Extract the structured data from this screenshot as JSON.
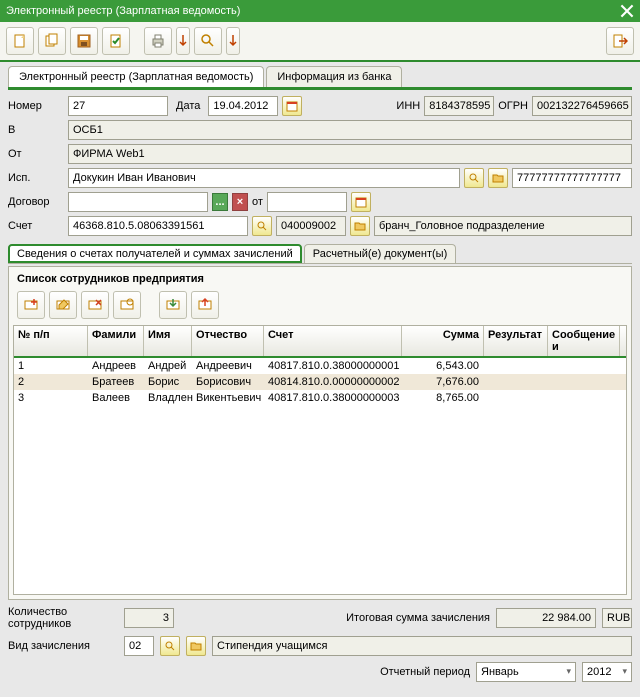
{
  "window": {
    "title": "Электронный реестр (Зарплатная ведомость)"
  },
  "tabs": {
    "main": "Электронный реестр (Зарплатная ведомость)",
    "bank": "Информация из банка"
  },
  "form": {
    "number_lbl": "Номер",
    "number": "27",
    "date_lbl": "Дата",
    "date": "19.04.2012",
    "inn_lbl": "ИНН",
    "inn": "8184378595",
    "ogrn_lbl": "ОГРН",
    "ogrn": "002132276459665",
    "to_lbl": "В",
    "to": "ОСБ1",
    "from_lbl": "От",
    "from": "ФИРМА Web1",
    "exec_lbl": "Исп.",
    "exec": "Докукин Иван Иванович",
    "phone": "77777777777777777",
    "contract_lbl": "Договор",
    "contract": "",
    "ot": "от",
    "contract_date": "",
    "acct_lbl": "Счет",
    "acct": "46368.810.5.08063391561",
    "acct2": "040009002",
    "branch": "бранч_Головное подразделение"
  },
  "subtabs": {
    "details": "Сведения о счетах получателей и суммах зачислений",
    "docs": "Расчетный(е) документ(ы)"
  },
  "list_title": "Список сотрудников предприятия",
  "cols": {
    "n": "№ п/п",
    "fam": "Фамили",
    "name": "Имя",
    "pat": "Отчество",
    "acct": "Счет",
    "sum": "Сумма",
    "res": "Результат",
    "msg": "Сообщение и"
  },
  "rows": [
    {
      "n": "1",
      "fam": "Андреев",
      "name": "Андрей",
      "pat": "Андреевич",
      "acct": "40817.810.0.38000000001",
      "sum": "6,543.00"
    },
    {
      "n": "2",
      "fam": "Братеев",
      "name": "Борис",
      "pat": "Борисович",
      "acct": "40814.810.0.00000000002",
      "sum": "7,676.00"
    },
    {
      "n": "3",
      "fam": "Валеев",
      "name": "Владлен",
      "pat": "Викентьевич",
      "acct": "40817.810.0.38000000003",
      "sum": "8,765.00"
    }
  ],
  "footer": {
    "count_lbl": "Количество сотрудников",
    "count": "3",
    "total_lbl": "Итоговая сумма зачисления",
    "total": "22 984.00",
    "cur": "RUB",
    "type_lbl": "Вид зачисления",
    "type_code": "02",
    "type_name": "Стипендия учащимся",
    "period_lbl": "Отчетный период",
    "month": "Январь",
    "year": "2012"
  }
}
